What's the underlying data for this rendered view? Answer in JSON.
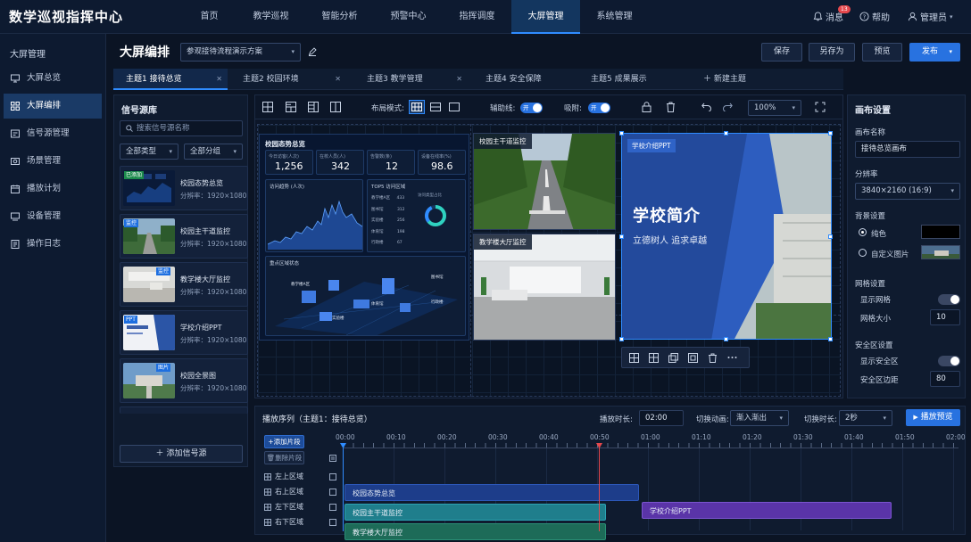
{
  "app": {
    "title": "数学巡视指挥中心"
  },
  "nav": [
    {
      "label": "首页"
    },
    {
      "label": "教学巡视"
    },
    {
      "label": "智能分析"
    },
    {
      "label": "预警中心"
    },
    {
      "label": "指挥调度"
    },
    {
      "label": "大屏管理",
      "active": true
    },
    {
      "label": "系统管理"
    }
  ],
  "header_right": {
    "messages": "消息",
    "badge": "13",
    "help": "帮助",
    "user": "管理员"
  },
  "sidebar": {
    "heading": "大屏管理",
    "items": [
      {
        "label": "大屏总览",
        "icon": "monitor-icon"
      },
      {
        "label": "大屏编排",
        "icon": "grid-icon",
        "active": true
      },
      {
        "label": "信号源管理",
        "icon": "signal-icon"
      },
      {
        "label": "场景管理",
        "icon": "scene-icon"
      },
      {
        "label": "播放计划",
        "icon": "calendar-icon"
      },
      {
        "label": "设备管理",
        "icon": "device-icon"
      },
      {
        "label": "操作日志",
        "icon": "log-icon"
      }
    ]
  },
  "page": {
    "title": "大屏编排",
    "scheme": "参观接待流程演示方案",
    "buttons": {
      "save": "保存",
      "save_as": "另存为",
      "preview": "预览",
      "publish": "发布"
    }
  },
  "themes": [
    {
      "label": "主题1  接待总览",
      "active": true
    },
    {
      "label": "主题2  校园环境"
    },
    {
      "label": "主题3  教学管理"
    },
    {
      "label": "主题4  安全保障"
    },
    {
      "label": "主题5  成果展示"
    }
  ],
  "new_theme": "新建主题",
  "source_panel": {
    "title": "信号源库",
    "search_placeholder": "搜索信号源名称",
    "filter_type": "全部类型",
    "filter_group": "全部分组",
    "items": [
      {
        "name": "校园态势总览",
        "res": "分辨率：1920×1080",
        "tag": "已添加"
      },
      {
        "name": "校园主干道监控",
        "res": "分辨率：1920×1080",
        "tag": "监控"
      },
      {
        "name": "教学楼大厅监控",
        "res": "分辨率：1920×1080",
        "tag": "监控"
      },
      {
        "name": "学校介绍PPT",
        "res": "分辨率：1920×1080",
        "tag": "PPT"
      },
      {
        "name": "校园全景图",
        "res": "分辨率：1920×1080",
        "tag": "图片"
      }
    ],
    "add_button": "添加信号源"
  },
  "toolbar": {
    "layout_mode": "布局模式:",
    "guides": "辅助线:",
    "snap": "吸附:",
    "on": "开",
    "zoom": "100%"
  },
  "canvas": {
    "dashboard": {
      "title": "校园态势总览",
      "kpis": [
        {
          "label": "今日访客(人次)",
          "value": "1,256"
        },
        {
          "label": "在校人员(人)",
          "value": "342"
        },
        {
          "label": "告警数(条)",
          "value": "12"
        },
        {
          "label": "设备在线率(%)",
          "value": "98.6"
        }
      ],
      "trend_title": "访问趋势 (人次)",
      "top_title": "TOP5 访问区域",
      "donut_title": "访问类型占比",
      "top_rows": [
        {
          "name": "教学楼A区",
          "v": "433"
        },
        {
          "name": "图书馆",
          "v": "312"
        },
        {
          "name": "实验楼",
          "v": "256"
        },
        {
          "name": "体育馆",
          "v": "198"
        },
        {
          "name": "行政楼",
          "v": "67"
        }
      ],
      "map_title": "重点区域状态",
      "map_labels": [
        "教学楼A区",
        "体育馆",
        "图书馆",
        "行政楼",
        "实验楼"
      ]
    },
    "cam1": {
      "title": "校园主干道监控"
    },
    "cam2": {
      "title": "教学楼大厅监控"
    },
    "ppt": {
      "tag": "学校介绍PPT",
      "title": "学校简介",
      "subtitle": "立德树人  追求卓越"
    }
  },
  "settings": {
    "title": "画布设置",
    "name_label": "画布名称",
    "name_value": "接待总览画布",
    "resolution_label": "分辨率",
    "resolution_value": "3840×2160 (16:9)",
    "bg_label": "背景设置",
    "bg_solid": "纯色",
    "bg_custom": "自定义图片",
    "grid_label": "网格设置",
    "show_grid": "显示网格",
    "grid_size_label": "网格大小",
    "grid_size": "10",
    "safe_label": "安全区设置",
    "show_safe": "显示安全区",
    "safe_margin_label": "安全区边距",
    "safe_margin": "80"
  },
  "timeline": {
    "title": "播放序列（主题1：接待总览）",
    "duration_label": "播放时长:",
    "duration": "02:00",
    "transition_label": "切换动画:",
    "transition": "渐入渐出",
    "switch_label": "切换时长:",
    "switch": "2秒",
    "preview_btn": "播放预览",
    "add_clip": "添加片段",
    "delete_clip": "删除片段",
    "ticks": [
      "00:00",
      "00:10",
      "00:20",
      "00:30",
      "00:40",
      "00:50",
      "01:00",
      "01:10",
      "01:20",
      "01:30",
      "01:40",
      "01:50",
      "02:00"
    ],
    "tracks": [
      "左上区域",
      "右上区域",
      "左下区域",
      "右下区域"
    ],
    "clips": [
      {
        "label": "校园态势总览",
        "color": "#1d3d8a"
      },
      {
        "label": "校园主干道监控",
        "color": "#1f7e8c"
      },
      {
        "label": "学校介绍PPT",
        "color": "#5a34a8"
      },
      {
        "label": "教学楼大厅监控",
        "color": "#1d6b58"
      }
    ]
  }
}
